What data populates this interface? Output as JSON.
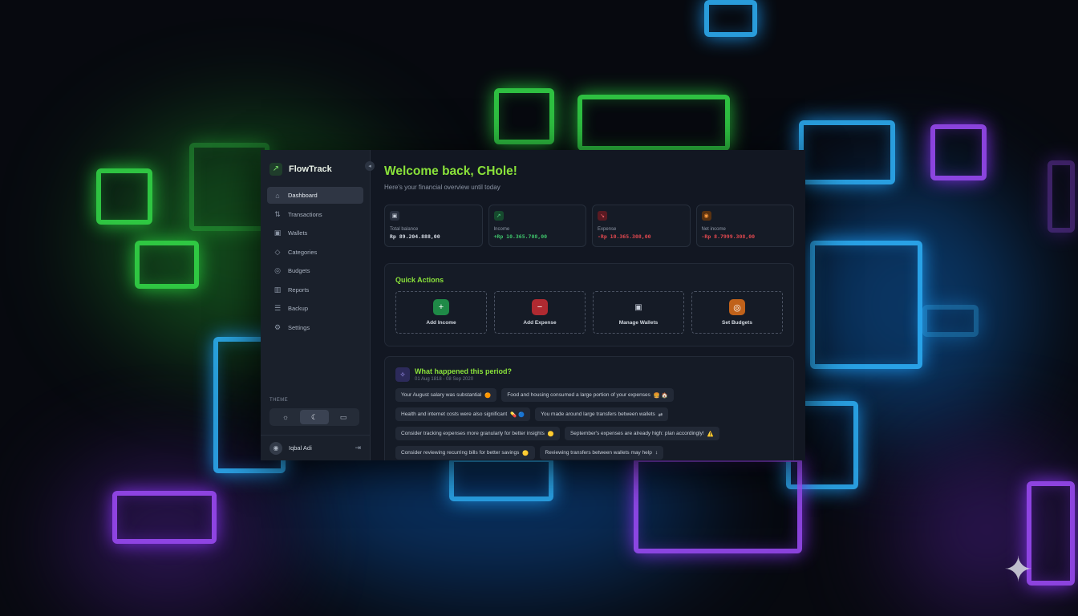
{
  "brand": {
    "name": "FlowTrack",
    "logo_icon": "trend-icon",
    "collapse_icon": "chevron-left-icon"
  },
  "nav": [
    {
      "label": "Dashboard",
      "icon": "home-icon",
      "active": true
    },
    {
      "label": "Transactions",
      "icon": "arrows-icon",
      "active": false
    },
    {
      "label": "Wallets",
      "icon": "wallet-icon",
      "active": false
    },
    {
      "label": "Categories",
      "icon": "tag-icon",
      "active": false
    },
    {
      "label": "Budgets",
      "icon": "target-icon",
      "active": false
    },
    {
      "label": "Reports",
      "icon": "bar-chart-icon",
      "active": false
    },
    {
      "label": "Backup",
      "icon": "database-icon",
      "active": false
    },
    {
      "label": "Settings",
      "icon": "gear-icon",
      "active": false
    }
  ],
  "theme": {
    "label": "THEME",
    "options": [
      "light",
      "dark",
      "system"
    ],
    "selected": "dark"
  },
  "user": {
    "name": "Iqbal Adi",
    "logout_icon": "logout-icon"
  },
  "header": {
    "welcome": "Welcome back, CHole!",
    "subtitle": "Here's your financial overview until today"
  },
  "stats": [
    {
      "label": "Total balance",
      "value": "Rp 89.204.888,00",
      "icon": "wallet-icon",
      "color": "#d7dde6",
      "icon_bg": "#2a3140"
    },
    {
      "label": "Income",
      "value": "+Rp 10.365.708,00",
      "icon": "trend-up-icon",
      "color": "#3fc36b",
      "icon_bg": "#164a2e"
    },
    {
      "label": "Expense",
      "value": "-Rp 10.365.308,00",
      "icon": "trend-down-icon",
      "color": "#e0484f",
      "icon_bg": "#5a1a22"
    },
    {
      "label": "Net income",
      "value": "-Rp 8.7999.308,00",
      "icon": "coin-icon",
      "color": "#e0484f",
      "icon_bg": "#5a3210"
    }
  ],
  "quick_actions": {
    "title": "Quick Actions",
    "items": [
      {
        "label": "Add Income",
        "icon": "plus-icon",
        "glyph": "+",
        "bg": "#1f8a47"
      },
      {
        "label": "Add Expense",
        "icon": "minus-icon",
        "glyph": "−",
        "bg": "#b02a31"
      },
      {
        "label": "Manage Wallets",
        "icon": "wallet-icon",
        "glyph": "▣",
        "bg": "transparent"
      },
      {
        "label": "Set Budgets",
        "icon": "target-icon",
        "glyph": "◎",
        "bg": "#c0621a"
      }
    ]
  },
  "insights": {
    "title": "What happened this period?",
    "date": "01 Aug 1818 - 08 Sep 2020",
    "icon": "sparkle-icon",
    "chips": [
      {
        "text": "Your August salary was substantial",
        "emoji": "🟠"
      },
      {
        "text": "Food and housing consumed a large portion of your expenses",
        "emoji": "🍔 🏠"
      },
      {
        "text": "Health and internet costs were also significant",
        "emoji": "💊 🔵"
      },
      {
        "text": "You made around large transfers between wallets",
        "emoji": "⇄"
      },
      {
        "text": "Consider tracking expenses more granularly for better insights",
        "emoji": "🟡"
      },
      {
        "text": "September's expenses are already high: plan accordingly!",
        "emoji": "⚠️"
      },
      {
        "text": "Consider reviewing recurring bills for better savings",
        "emoji": "🟡"
      },
      {
        "text": "Reviewing transfers between wallets may help",
        "emoji": "↕"
      }
    ]
  }
}
